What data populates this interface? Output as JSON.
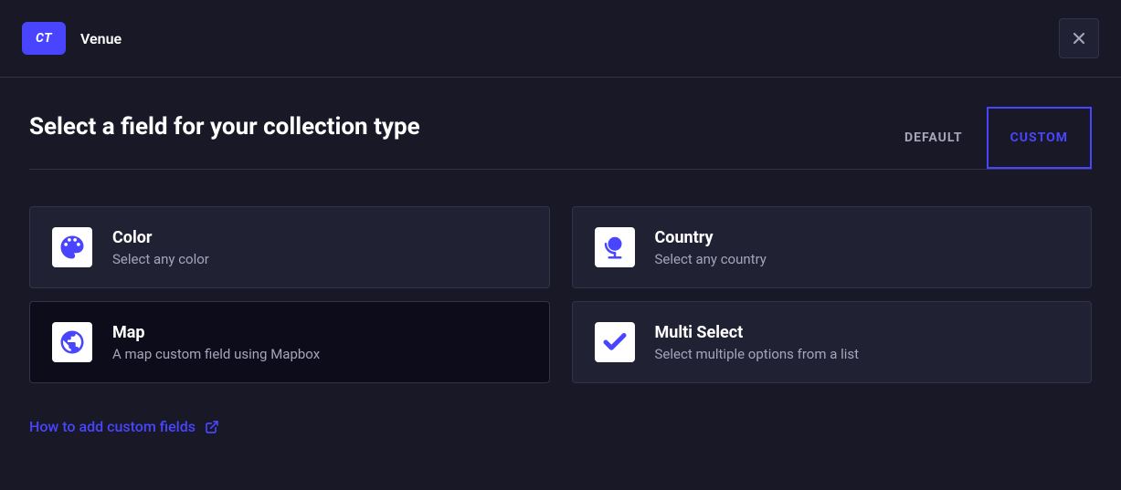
{
  "header": {
    "badge": "CT",
    "title": "Venue"
  },
  "main": {
    "heading": "Select a field for your collection type",
    "tabs": {
      "default": "DEFAULT",
      "custom": "CUSTOM"
    },
    "fields": [
      {
        "title": "Color",
        "description": "Select any color",
        "icon": "palette",
        "highlighted": false
      },
      {
        "title": "Country",
        "description": "Select any country",
        "icon": "globe",
        "highlighted": false
      },
      {
        "title": "Map",
        "description": "A map custom field using Mapbox",
        "icon": "earth",
        "highlighted": true
      },
      {
        "title": "Multi Select",
        "description": "Select multiple options from a list",
        "icon": "check",
        "highlighted": false
      }
    ],
    "help_link": "How to add custom fields"
  }
}
